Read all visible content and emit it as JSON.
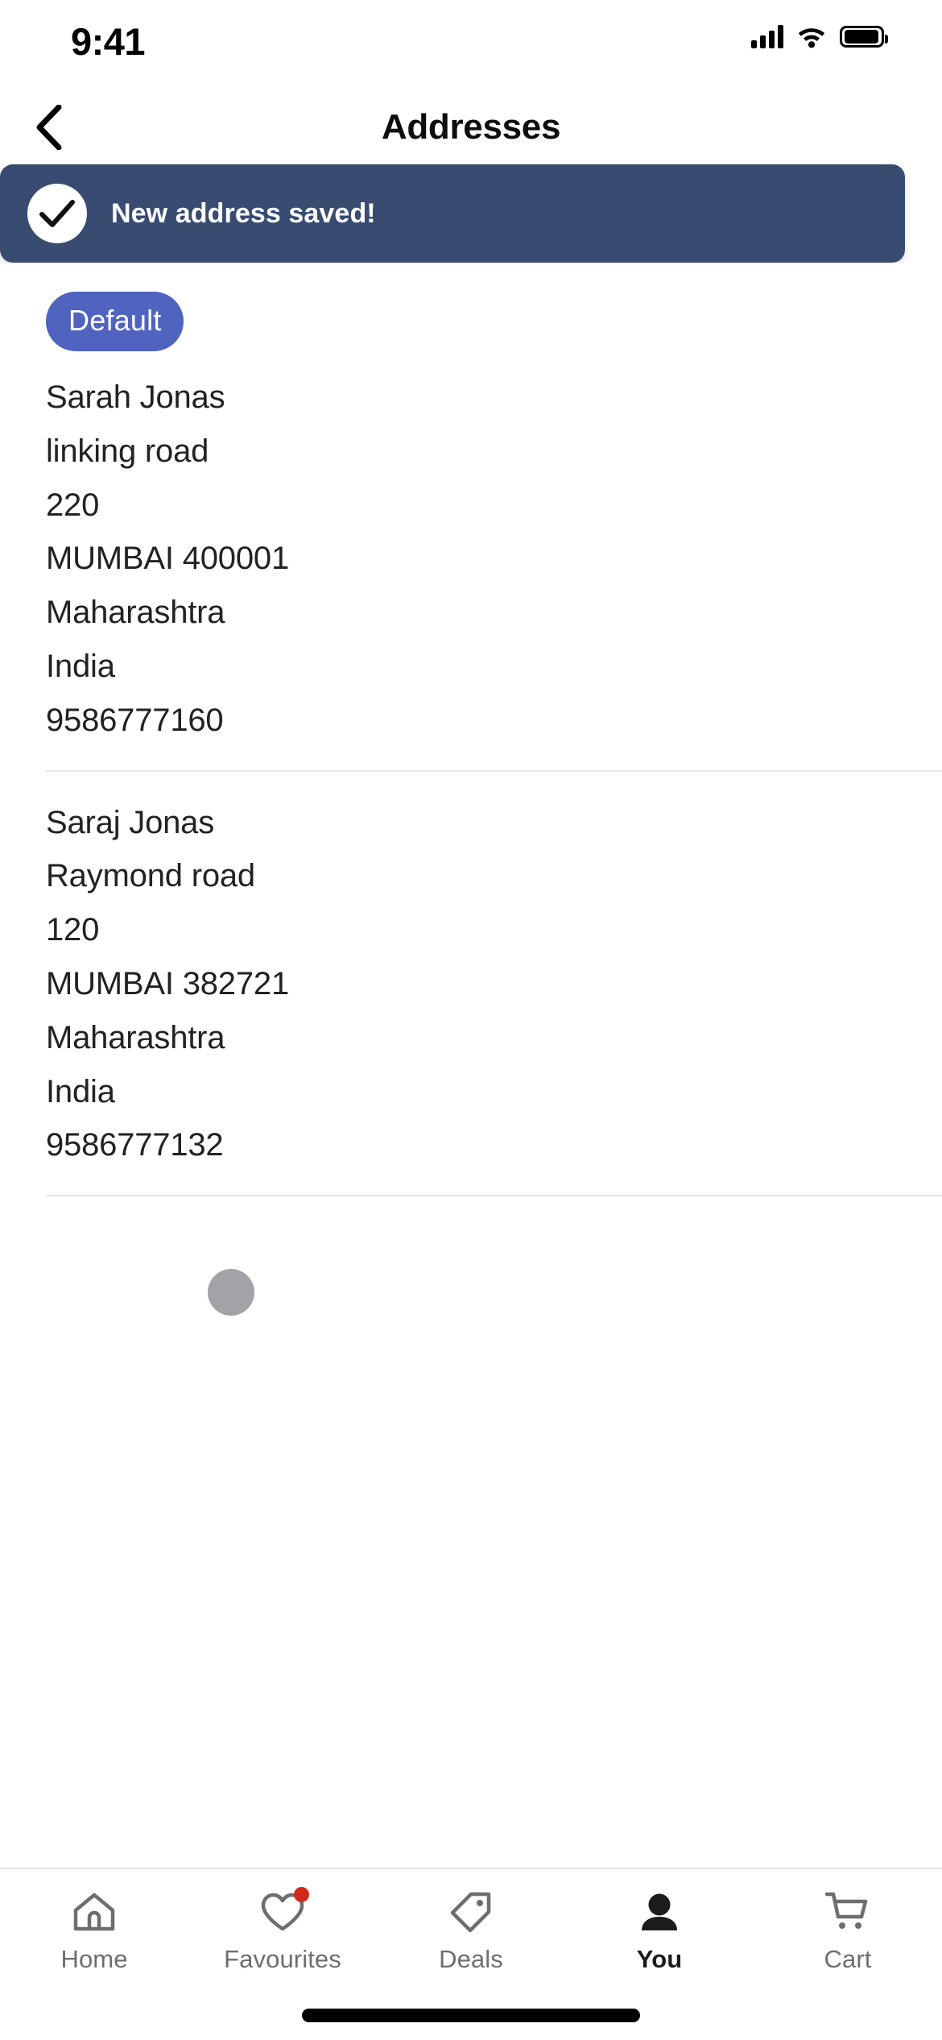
{
  "status_bar": {
    "time": "9:41",
    "cellular_icon": "signal-bars-icon",
    "wifi_icon": "wifi-icon",
    "battery_icon": "battery-full-icon"
  },
  "nav": {
    "back_icon": "chevron-left-icon",
    "title": "Addresses"
  },
  "toast": {
    "icon": "check-circle-icon",
    "message": "New address saved!",
    "background_color": "#384c72",
    "text_color": "#ffffff"
  },
  "addresses": [
    {
      "badge": "Default",
      "badge_color": "#5063bf",
      "lines": [
        "Sarah Jonas",
        "linking road",
        "220",
        "MUMBAI 400001",
        "Maharashtra",
        "India",
        "9586777160"
      ]
    },
    {
      "badge": null,
      "lines": [
        "Saraj Jonas",
        "Raymond road",
        "120",
        "MUMBAI 382721",
        "Maharashtra",
        "India",
        "9586777132"
      ]
    }
  ],
  "loading_indicator": {
    "name": "loading-dot",
    "color": "#a3a3a7"
  },
  "tab_bar": {
    "items": [
      {
        "label": "Home",
        "icon": "home-icon",
        "active": false,
        "badge": false
      },
      {
        "label": "Favourites",
        "icon": "heart-icon",
        "active": false,
        "badge": true
      },
      {
        "label": "Deals",
        "icon": "tag-icon",
        "active": false,
        "badge": false
      },
      {
        "label": "You",
        "icon": "person-icon",
        "active": true,
        "badge": false
      },
      {
        "label": "Cart",
        "icon": "cart-icon",
        "active": false,
        "badge": false
      }
    ],
    "badge_color": "#cf2a1a",
    "inactive_color": "#6e6e6e",
    "active_color": "#1c1c1e"
  },
  "home_indicator": {
    "name": "home-indicator"
  }
}
